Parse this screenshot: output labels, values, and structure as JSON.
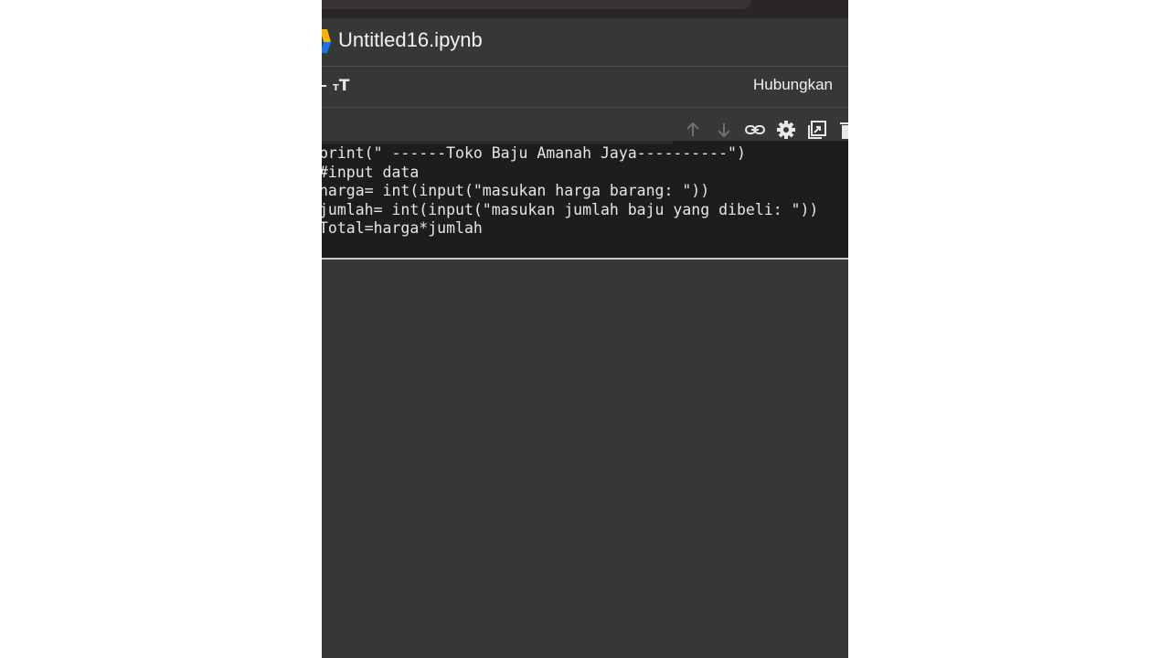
{
  "notebook": {
    "title": "Untitled16.ipynb"
  },
  "toolbar": {
    "text_cell_icon": "text-format-icon",
    "connect_label": "Hubungkan"
  },
  "cell_toolbar": {
    "icons": [
      "arrow-up-icon",
      "arrow-down-icon",
      "link-icon",
      "gear-icon",
      "mirror-cell-icon",
      "delete-icon"
    ]
  },
  "code_cell": {
    "lines": [
      "print(\" ------Toko Baju Amanah Jaya----------\")",
      "#input data",
      "harga= int(input(\"masukan harga barang: \"))",
      "jumlah= int(input(\"masukan jumlah baju yang dibeli: \"))",
      "Total=harga*jumlah"
    ]
  },
  "colors": {
    "background": "#353834",
    "code_background": "#1b1e1b",
    "text": "#e6e6e6"
  }
}
